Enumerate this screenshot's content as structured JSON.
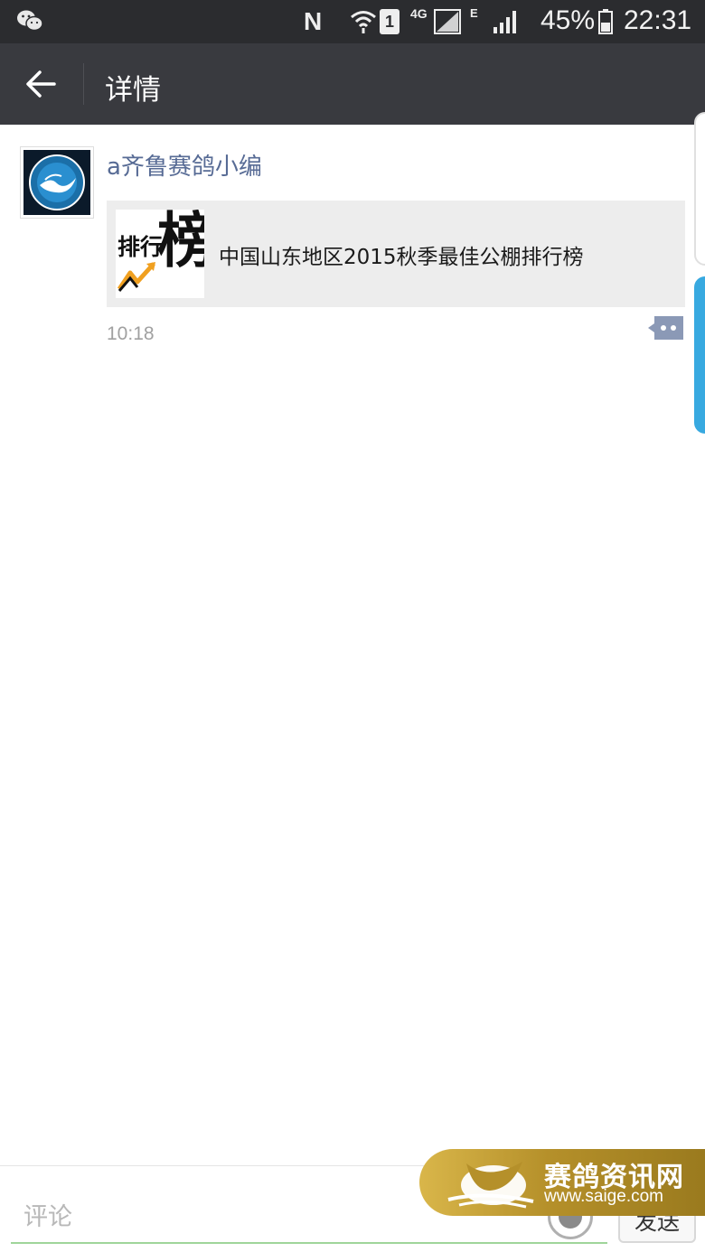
{
  "status_bar": {
    "network_type": "4G",
    "network_edge": "E",
    "sim_slot": "1",
    "battery": "45%",
    "time": "22:31",
    "icons": [
      "wechat-icon",
      "nfc-icon",
      "wifi-icon",
      "sim-icon",
      "signal-icon",
      "battery-icon"
    ]
  },
  "header": {
    "title": "详情",
    "back_icon": "arrow-left-icon"
  },
  "post": {
    "author": "a齐鲁赛鸽小编",
    "card": {
      "thumb_small_text": "排行",
      "thumb_big_text": "榜",
      "title": "中国山东地区2015秋季最佳公棚排行榜"
    },
    "time": "10:18",
    "comment_icon": "comment-bubble-icon"
  },
  "comment_bar": {
    "placeholder": "评论",
    "send_label": "发送",
    "emoji_icon": "emoji-icon"
  },
  "watermark": {
    "name": "赛鸽资讯网",
    "url": "www.saige.com"
  },
  "colors": {
    "status_bar_bg": "#2b2c2f",
    "title_bar_bg": "#393a3f",
    "author_link": "#576b95",
    "card_bg": "#ededed",
    "input_underline": "#9fd59a",
    "side_tab_blue": "#38a9e0",
    "watermark_gold": "#b5902a"
  }
}
